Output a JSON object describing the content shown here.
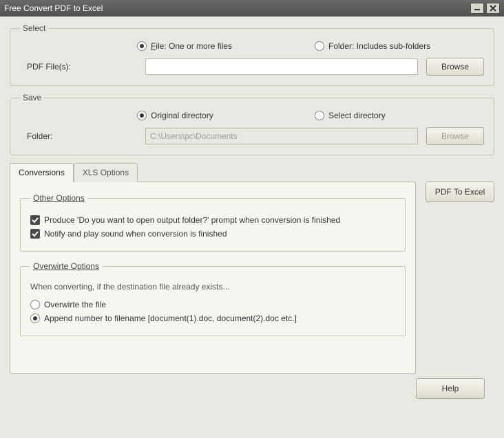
{
  "title": "Free Convert PDF to Excel",
  "select": {
    "legend": "Select",
    "file_prefix": "F",
    "file_label": "ile:  One or more files",
    "folder_label": "Folder: Includes sub-folders",
    "pdf_label": "PDF File(s):",
    "pdf_value": "",
    "browse": "Browse"
  },
  "save": {
    "legend": "Save",
    "orig": "Original directory",
    "sel": "Select directory",
    "folder_label": "Folder:",
    "folder_value": "C:\\Users\\pc\\Documents",
    "browse": "Browse"
  },
  "tabs": {
    "conv": "Conversions",
    "xls": "XLS Options"
  },
  "other": {
    "legend": "Other Options",
    "prompt": "Produce 'Do you want to open output folder?' prompt when conversion is finished",
    "notify": "Notify and play sound when conversion is finished"
  },
  "over": {
    "legend": "Overwirte Options",
    "desc": "When converting, if the destination file already exists...",
    "overwrite": "Overwirte the file",
    "append": "Append number to filename  [document(1).doc, document(2).doc etc.]"
  },
  "buttons": {
    "pdf2excel": "PDF To Excel",
    "help": "Help"
  }
}
